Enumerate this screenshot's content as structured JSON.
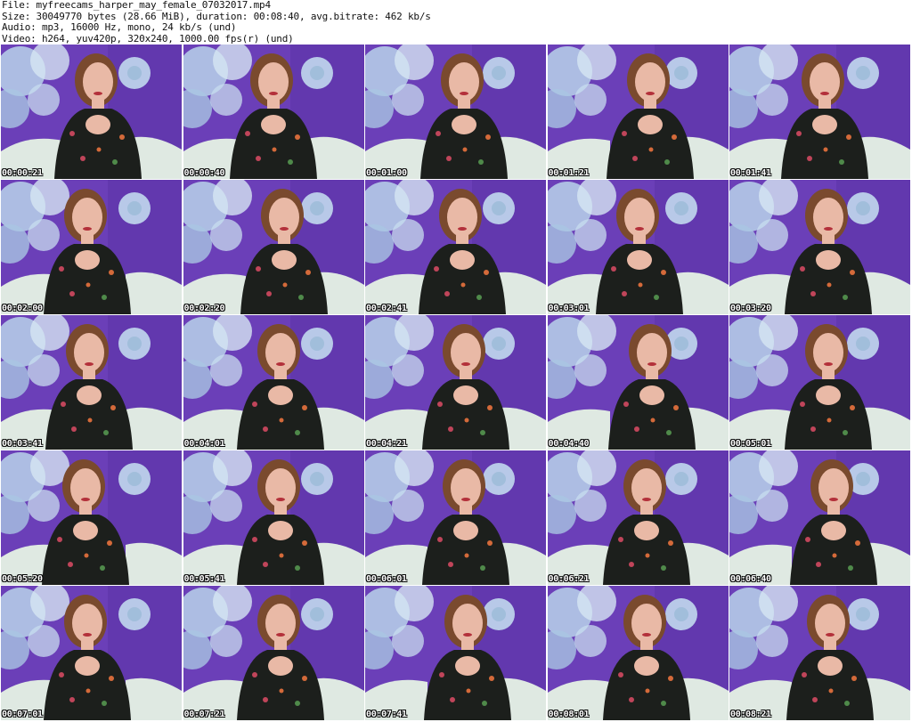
{
  "header": {
    "file_line": "File: myfreecams_harper_may_female_07032017.mp4",
    "size_line": "Size: 30049770 bytes (28.66 MiB), duration: 00:08:40, avg.bitrate: 462 kb/s",
    "audio_line": "Audio: mp3, 16000 Hz, mono, 24 kb/s (und)",
    "video_line": "Video: h264, yuv420p, 320x240, 1000.00 fps(r) (und)"
  },
  "frames": [
    {
      "timestamp": "00:00:21"
    },
    {
      "timestamp": "00:00:40"
    },
    {
      "timestamp": "00:01:00"
    },
    {
      "timestamp": "00:01:21"
    },
    {
      "timestamp": "00:01:41"
    },
    {
      "timestamp": "00:02:00"
    },
    {
      "timestamp": "00:02:20"
    },
    {
      "timestamp": "00:02:41"
    },
    {
      "timestamp": "00:03:01"
    },
    {
      "timestamp": "00:03:20"
    },
    {
      "timestamp": "00:03:41"
    },
    {
      "timestamp": "00:04:01"
    },
    {
      "timestamp": "00:04:21"
    },
    {
      "timestamp": "00:04:40"
    },
    {
      "timestamp": "00:05:01"
    },
    {
      "timestamp": "00:05:20"
    },
    {
      "timestamp": "00:05:41"
    },
    {
      "timestamp": "00:06:01"
    },
    {
      "timestamp": "00:06:21"
    },
    {
      "timestamp": "00:06:40"
    },
    {
      "timestamp": "00:07:01"
    },
    {
      "timestamp": "00:07:21"
    },
    {
      "timestamp": "00:07:41"
    },
    {
      "timestamp": "00:08:01"
    },
    {
      "timestamp": "00:08:21"
    }
  ],
  "colors": {
    "backdrop_purple": "#6b3fb8",
    "flower_blue": "#b9d4ea",
    "sofa": "#dfe9e2",
    "dress": "#1c1f1c",
    "skin": "#e9b9a6",
    "hair": "#7a4a2e"
  }
}
